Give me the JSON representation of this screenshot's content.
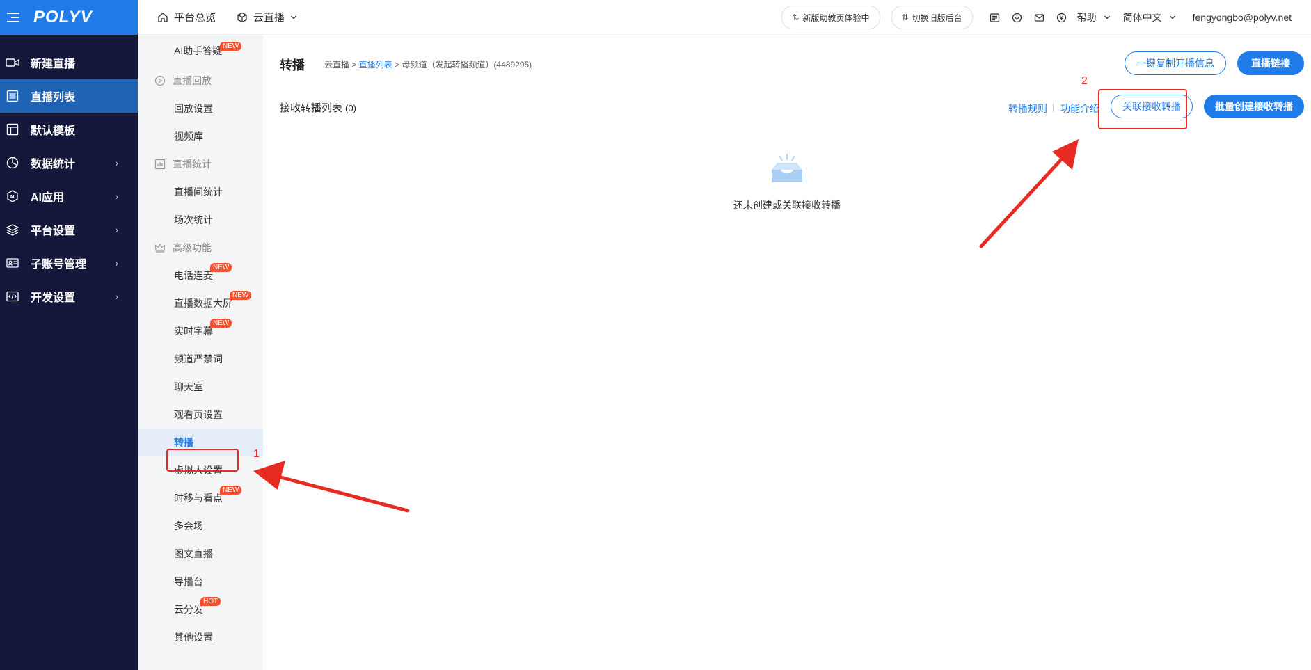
{
  "brand": {
    "logo": "POLYV"
  },
  "sidebar": {
    "items": [
      {
        "label": "新建直播",
        "icon": "video-camera-icon",
        "has_arrow": false
      },
      {
        "label": "直播列表",
        "icon": "list-icon",
        "has_arrow": false,
        "active": true
      },
      {
        "label": "默认模板",
        "icon": "template-icon",
        "has_arrow": false
      },
      {
        "label": "数据统计",
        "icon": "pie-chart-icon",
        "has_arrow": true
      },
      {
        "label": "AI应用",
        "icon": "ai-icon",
        "has_arrow": true
      },
      {
        "label": "平台设置",
        "icon": "layers-icon",
        "has_arrow": true
      },
      {
        "label": "子账号管理",
        "icon": "id-card-icon",
        "has_arrow": true
      },
      {
        "label": "开发设置",
        "icon": "code-icon",
        "has_arrow": true
      }
    ],
    "chevron": "›"
  },
  "topbar": {
    "overview": "平台总览",
    "cloud_live": "云直播",
    "pill_new": "新版助教页体验中",
    "pill_old": "切换旧版后台",
    "help": "帮助",
    "language": "简体中文",
    "user": "fengyongbo@polyv.net"
  },
  "submenu": {
    "ai_assistant": {
      "label": "AI助手答疑",
      "badge": "NEW"
    },
    "groups": [
      {
        "title": "直播回放",
        "icon": "playback-icon",
        "items": [
          {
            "label": "回放设置"
          },
          {
            "label": "视频库"
          }
        ]
      },
      {
        "title": "直播统计",
        "icon": "bar-chart-icon",
        "items": [
          {
            "label": "直播间统计"
          },
          {
            "label": "场次统计"
          }
        ]
      },
      {
        "title": "高级功能",
        "icon": "crown-icon",
        "items": [
          {
            "label": "电话连麦",
            "badge": "NEW"
          },
          {
            "label": "直播数据大屏",
            "badge": "NEW"
          },
          {
            "label": "实时字幕",
            "badge": "NEW"
          },
          {
            "label": "频道严禁词"
          },
          {
            "label": "聊天室"
          },
          {
            "label": "观看页设置"
          },
          {
            "label": "转播",
            "active": true
          },
          {
            "label": "虚拟人设置"
          },
          {
            "label": "时移与看点",
            "badge": "NEW"
          },
          {
            "label": "多会场"
          },
          {
            "label": "图文直播"
          },
          {
            "label": "导播台"
          },
          {
            "label": "云分发",
            "badge": "HOT"
          },
          {
            "label": "其他设置"
          }
        ]
      }
    ]
  },
  "main": {
    "title": "转播",
    "breadcrumb": {
      "root": "云直播",
      "sep": ">",
      "list": "直播列表",
      "channel": "母频道（发起转播频道）(4489295)"
    },
    "copy_button": "一键复制开播信息",
    "link_button": "直播链接",
    "section_title": "接收转播列表",
    "section_count": "(0)",
    "rules_link": "转播规则",
    "intro_link": "功能介绍",
    "associate_button": "关联接收转播",
    "batch_button": "批量创建接收转播",
    "empty_text": "还未创建或关联接收转播"
  },
  "annotations": {
    "step1": "1",
    "step2": "2",
    "color": "#e82b22"
  },
  "colors": {
    "sidebar_bg": "#14183a",
    "brand_blue": "#1f7be8",
    "active_nav": "#1f63b5",
    "badge": "#f5512e"
  }
}
